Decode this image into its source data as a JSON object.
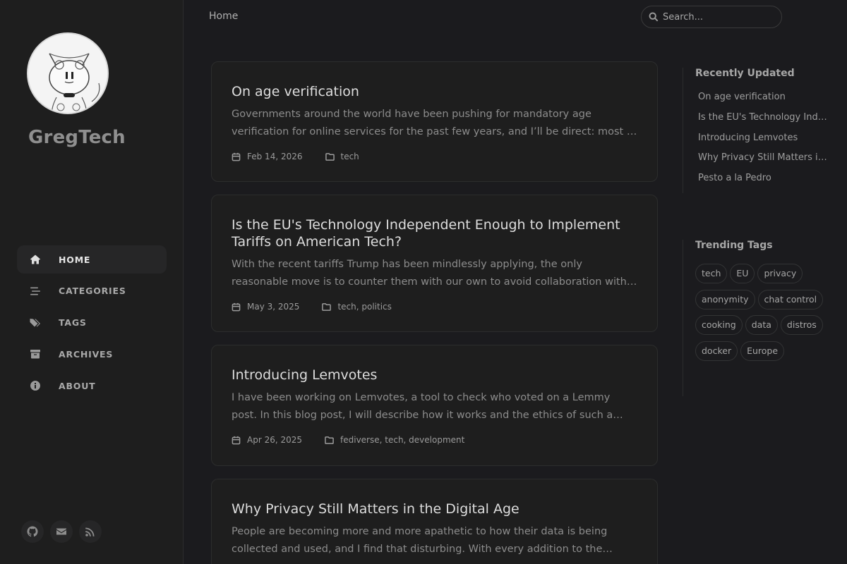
{
  "site": {
    "title": "GregTech"
  },
  "nav": [
    {
      "label": "HOME",
      "icon": "home-icon",
      "active": true
    },
    {
      "label": "CATEGORIES",
      "icon": "stream-icon"
    },
    {
      "label": "TAGS",
      "icon": "tags-icon"
    },
    {
      "label": "ARCHIVES",
      "icon": "archive-icon"
    },
    {
      "label": "ABOUT",
      "icon": "info-icon"
    }
  ],
  "social": [
    "github-icon",
    "email-icon",
    "rss-icon"
  ],
  "topbar": {
    "breadcrumb": "Home",
    "search_placeholder": "Search..."
  },
  "posts": [
    {
      "title": "On age verification",
      "excerpt": "Governments around the world have been pushing for mandatory age verification for online services for the past few years, and I’ll be direct: most of this is utterly pointless and dangerous for our privacy.",
      "date": "Feb 14, 2026",
      "categories": "tech"
    },
    {
      "title": "Is the EU's Technology Independent Enough to Implement Tariffs on American Tech?",
      "excerpt": "With the recent tariffs Trump has been mindlessly applying, the only reasonable move is to counter them with our own to avoid collaboration with the insane administration.",
      "date": "May 3, 2025",
      "categories": "tech, politics"
    },
    {
      "title": "Introducing Lemvotes",
      "excerpt": "I have been working on Lemvotes, a tool to check who voted on a Lemmy post. In this blog post, I will describe how it works and the ethics of such a tool. Why I made it and more.",
      "date": "Apr 26, 2025",
      "categories": "fediverse, tech, development"
    },
    {
      "title": "Why Privacy Still Matters in the Digital Age",
      "excerpt": "People are becoming more and more apathetic to how their data is being collected and used, and I find that disturbing. With every addition to the tracking and sale of our data we lose a bit more.",
      "date": "",
      "categories": ""
    }
  ],
  "recently_updated": {
    "title": "Recently Updated",
    "items": [
      "On age verification",
      "Is the EU's Technology Independent Enough to Implement Tariffs on American Tech?",
      "Introducing Lemvotes",
      "Why Privacy Still Matters in the Digital Age",
      "Pesto a la Pedro"
    ]
  },
  "trending_tags": {
    "title": "Trending Tags",
    "items": [
      "tech",
      "EU",
      "privacy",
      "anonymity",
      "chat control",
      "cooking",
      "data",
      "distros",
      "docker",
      "Europe"
    ]
  },
  "colors": {
    "background": "#1b1b1e",
    "sidebar": "#1e1e1e",
    "card": "#1e1e1e",
    "border": "#2c2d2d",
    "title_text": "#dddddd",
    "muted_text": "#8c8c8c"
  }
}
